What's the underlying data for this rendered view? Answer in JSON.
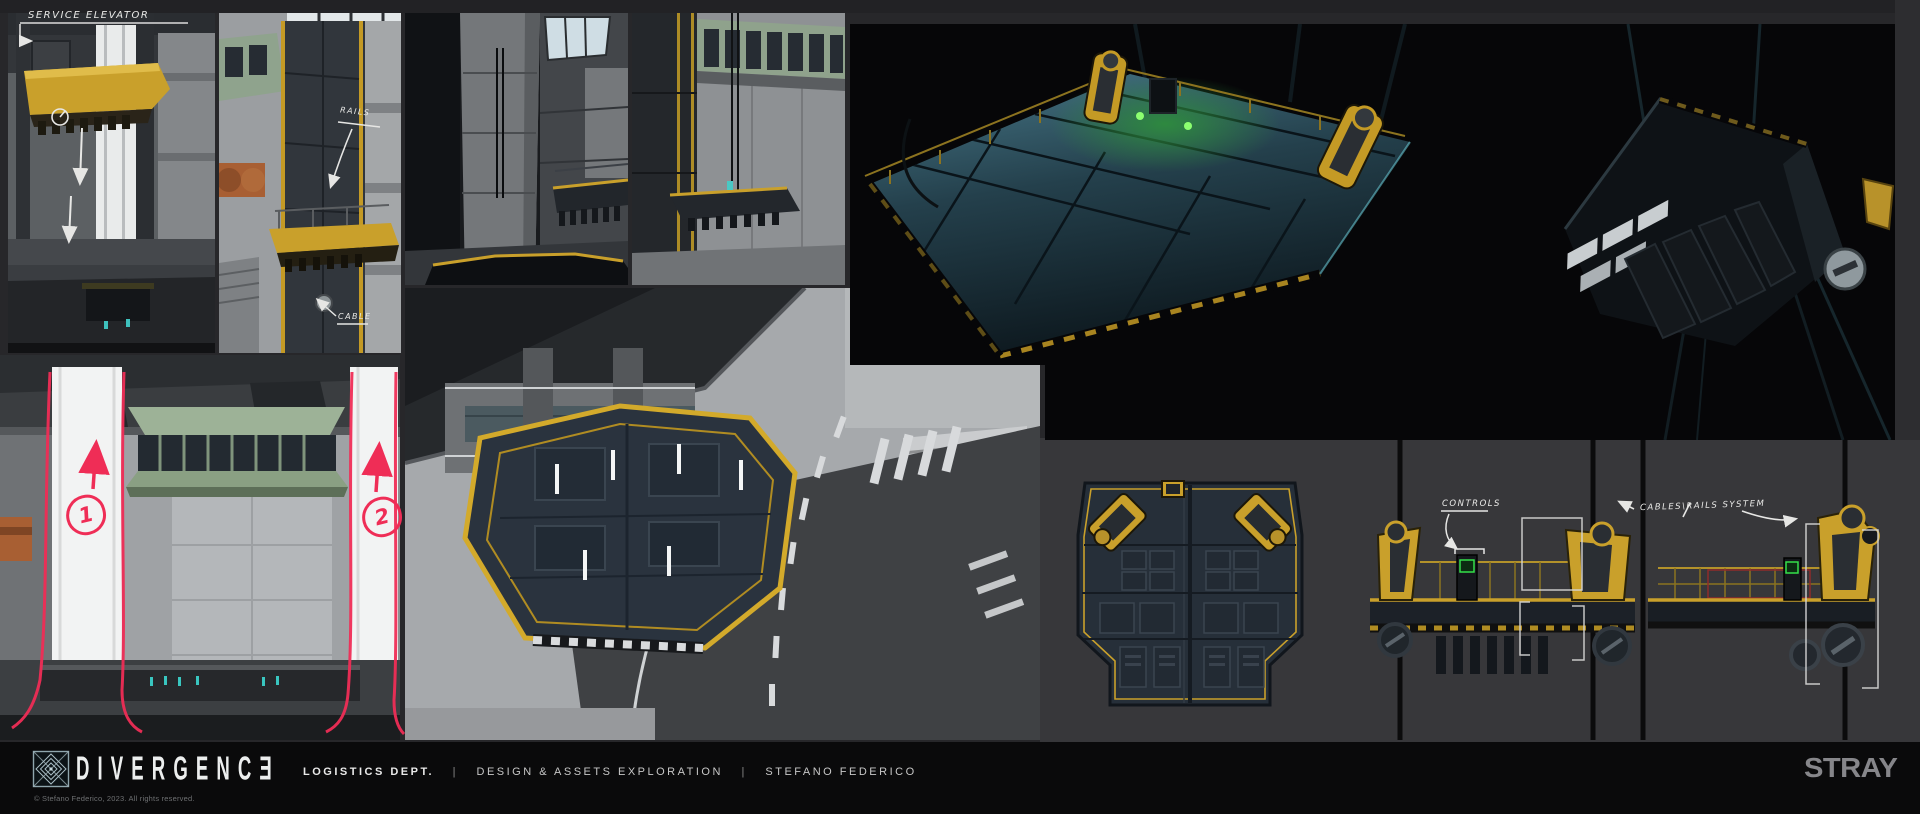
{
  "annotations": {
    "service_elevator": "SERVICE ELEVATOR",
    "rails": "RAILS",
    "cable": "CABLE",
    "controls": "CONTROLS",
    "cables_rails_system": "CABLES\\RAILS SYSTEM",
    "marker_1": "1",
    "marker_2": "2"
  },
  "footer": {
    "wordmark": "DIVERGENCƎ",
    "department": "LOGISTICS DEPT.",
    "separator": "|",
    "project": "DESIGN & ASSETS EXPLORATION",
    "author": "STEFANO FEDERICO",
    "copyright": "© Stefano Federico, 2023. All rights reserved.",
    "studio": "STRAY"
  },
  "colors": {
    "accent_yellow": "#c9a02b",
    "annotation_red": "#ef2d56",
    "glow_green": "#46d860",
    "teal_deck": "#3a6673",
    "panel_black": "#060608",
    "background_gray": "#27272a"
  }
}
